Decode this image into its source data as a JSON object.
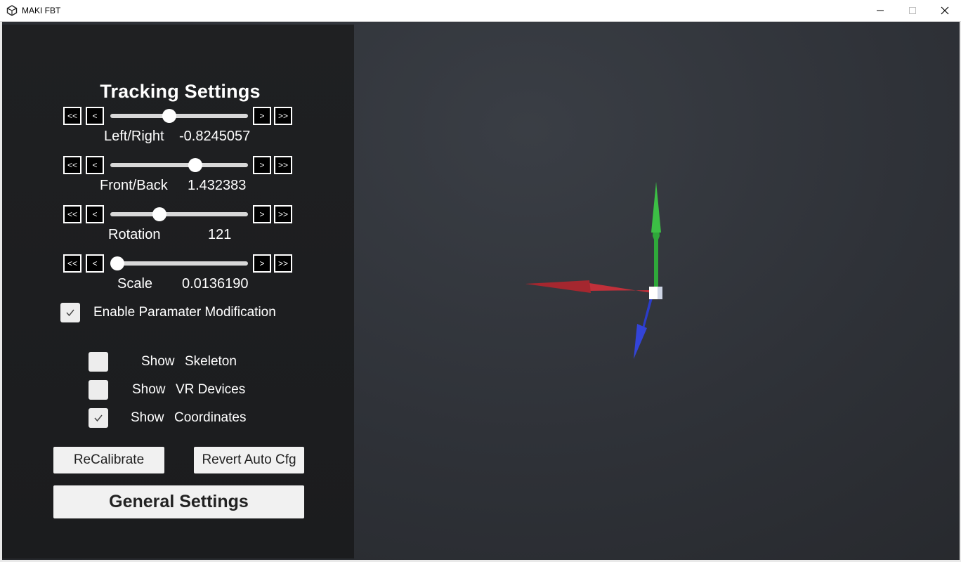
{
  "window": {
    "title": "MAKI FBT",
    "controls": [
      "minimize",
      "maximize",
      "close"
    ]
  },
  "panel": {
    "title": "Tracking Settings",
    "stepper_labels": {
      "fast_back": "<<",
      "back": "<",
      "forward": ">",
      "fast_forward": ">>"
    },
    "params": [
      {
        "label": "Left/Right",
        "value": "-0.8245057",
        "slider_fraction": 0.42
      },
      {
        "label": "Front/Back",
        "value": "1.432383",
        "slider_fraction": 0.63
      },
      {
        "label": "Rotation",
        "value": "121",
        "slider_fraction": 0.34
      },
      {
        "label": "Scale",
        "value": "0.0136190",
        "slider_fraction": 0.0
      }
    ],
    "enable_param_mod": {
      "label": "Enable Paramater Modification",
      "checked": true
    },
    "show_options": [
      {
        "word": "Show",
        "label": "Skeleton",
        "checked": false
      },
      {
        "word": "Show",
        "label": "VR Devices",
        "checked": false
      },
      {
        "word": "Show",
        "label": "Coordinates",
        "checked": true
      }
    ],
    "buttons": {
      "recalibrate": "ReCalibrate",
      "revert": "Revert Auto Cfg",
      "general": "General Settings"
    }
  },
  "viewport": {
    "gizmo_colors": {
      "x_axis": "#c0303a",
      "y_axis": "#2fa83a",
      "z_axis": "#2b3cc9",
      "origin": "#ffffff"
    }
  }
}
